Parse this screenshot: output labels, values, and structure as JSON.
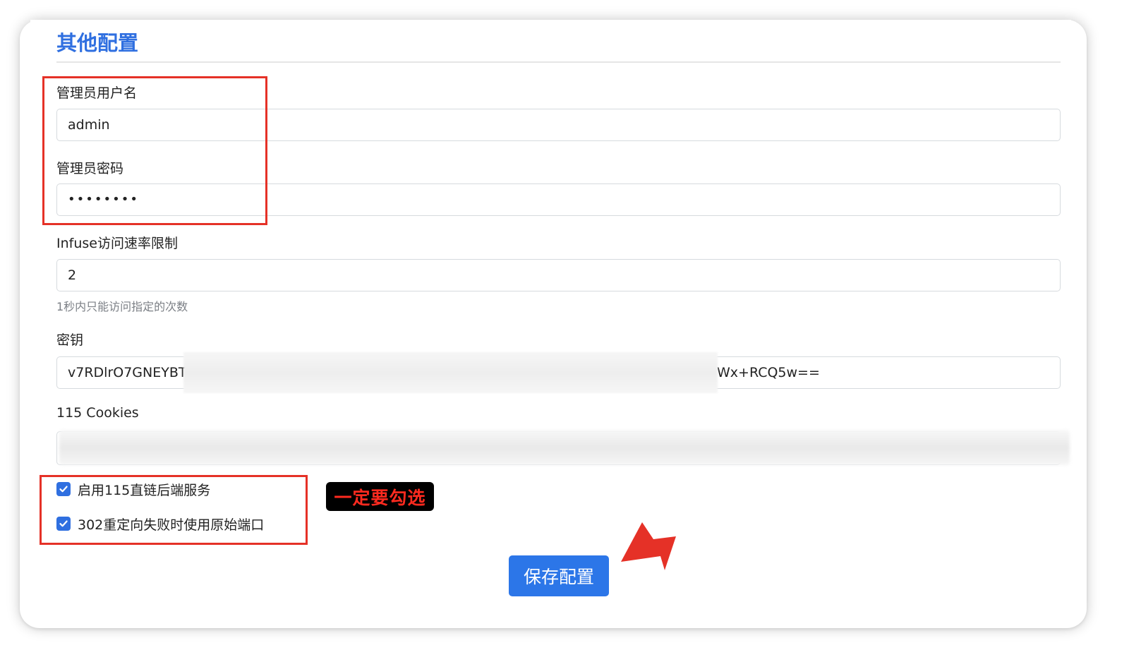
{
  "section": {
    "title": "其他配置"
  },
  "admin_username": {
    "label": "管理员用户名",
    "value": "admin"
  },
  "admin_password": {
    "label": "管理员密码",
    "value": "••••••••"
  },
  "infuse_rate": {
    "label": "Infuse访问速率限制",
    "value": "2",
    "hint": "1秒内只能访问指定的次数"
  },
  "secret_key": {
    "label": "密钥",
    "value_start": "v7RDlrO7GNEYBT",
    "value_end": "Wx+RCQ5w=="
  },
  "cookies": {
    "label": "115 Cookies"
  },
  "options": {
    "enable_direct_link": {
      "label": "启用115直链后端服务",
      "checked": true
    },
    "use_original_port": {
      "label": "302重定向失败时使用原始端口",
      "checked": true
    }
  },
  "annotation": {
    "tag": "一定要勾选"
  },
  "actions": {
    "save_label": "保存配置"
  },
  "colors": {
    "accent": "#2f6fe0",
    "annotation_red": "#e53127",
    "button": "#2c76e8"
  }
}
